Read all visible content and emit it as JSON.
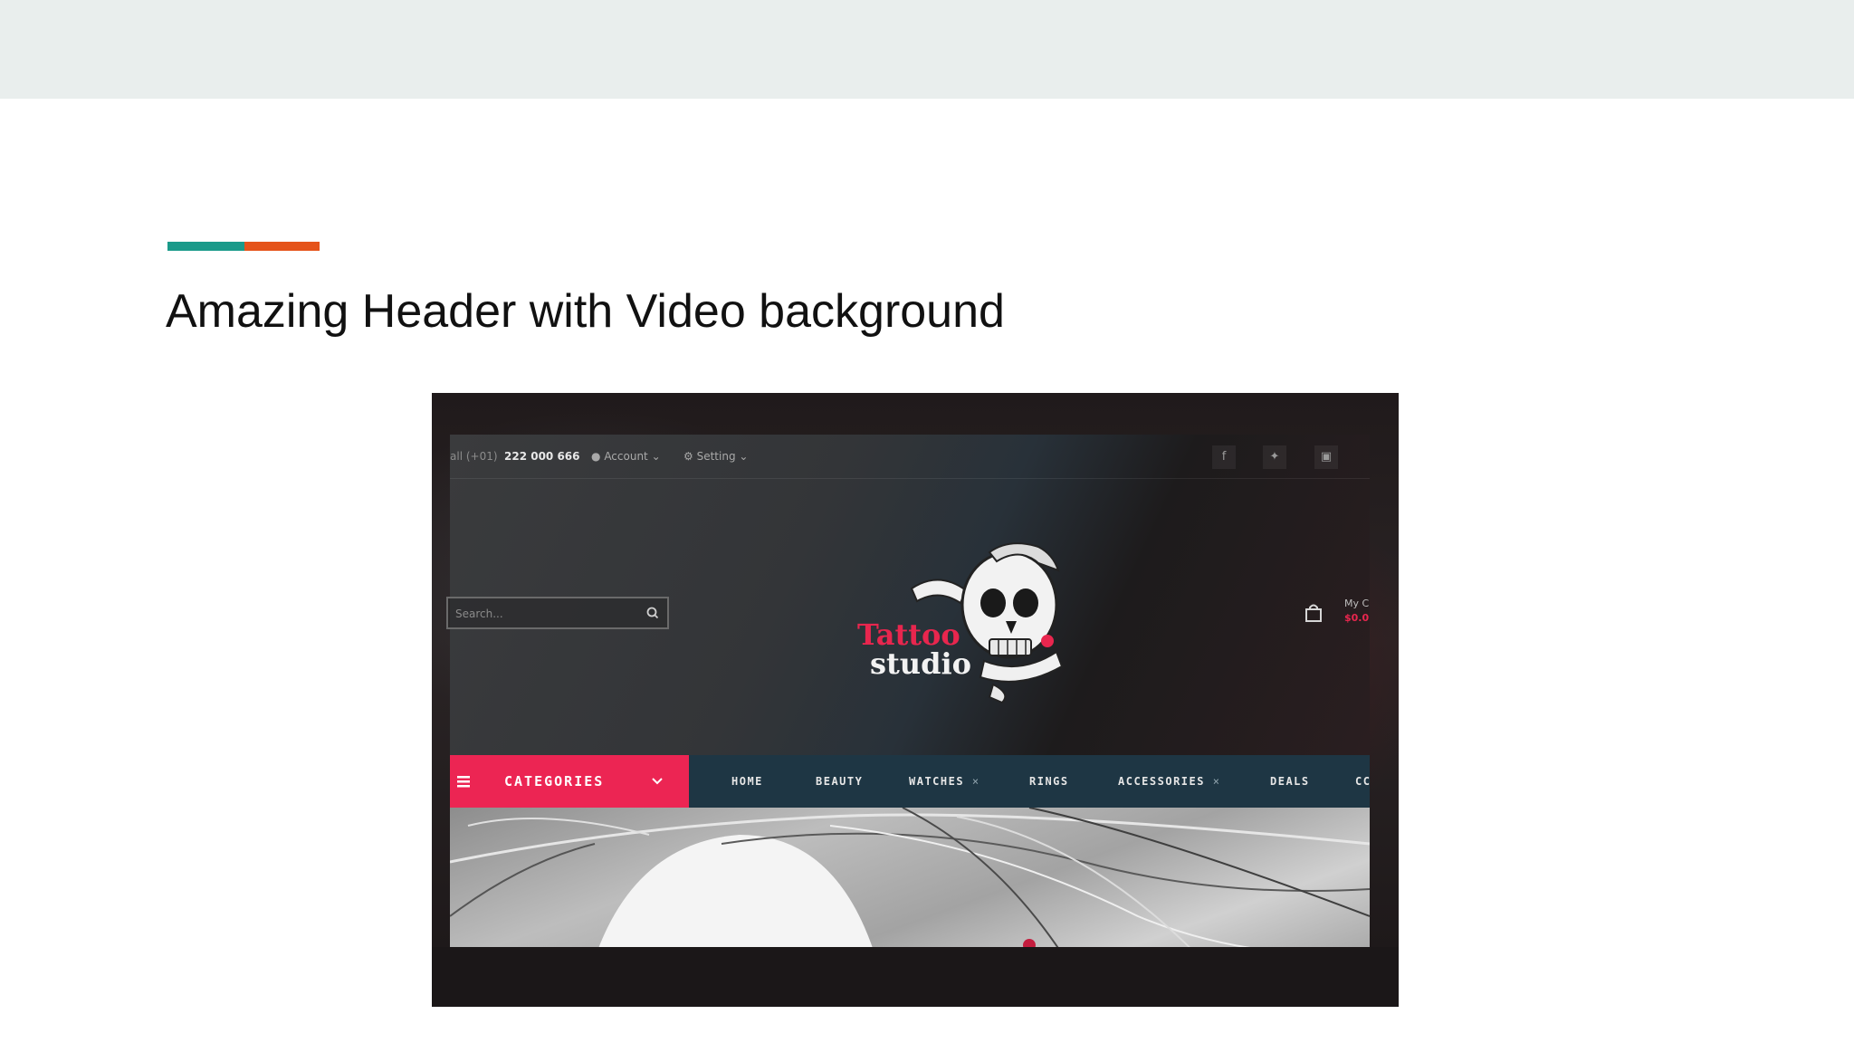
{
  "slide": {
    "title": "Amazing Header with Video background",
    "accent_colors": [
      "#1a9a8a",
      "#e5531a"
    ]
  },
  "screenshot": {
    "top_bar": {
      "phone_label": "all (+01)",
      "phone_number": "222 000 666",
      "account_label": "Account",
      "setting_label": "Setting",
      "social_icons": [
        "facebook-icon",
        "twitter-icon",
        "instagram-icon"
      ]
    },
    "search": {
      "placeholder": "Search..."
    },
    "logo": {
      "line1": "Tattoo",
      "line2": "studio"
    },
    "cart": {
      "label": "My C",
      "total": "$0.0"
    },
    "nav": {
      "categories_label": "CATEGORIES",
      "items": [
        {
          "label": "HOME",
          "has_x": false
        },
        {
          "label": "BEAUTY",
          "has_x": false
        },
        {
          "label": "WATCHES",
          "has_x": true
        },
        {
          "label": "RINGS",
          "has_x": false
        },
        {
          "label": "ACCESSORIES",
          "has_x": true
        },
        {
          "label": "DEALS",
          "has_x": false
        },
        {
          "label": "CC",
          "has_x": false
        }
      ],
      "colors": {
        "categories_bg": "#ec2553",
        "nav_bg": "#1e3644"
      }
    }
  }
}
